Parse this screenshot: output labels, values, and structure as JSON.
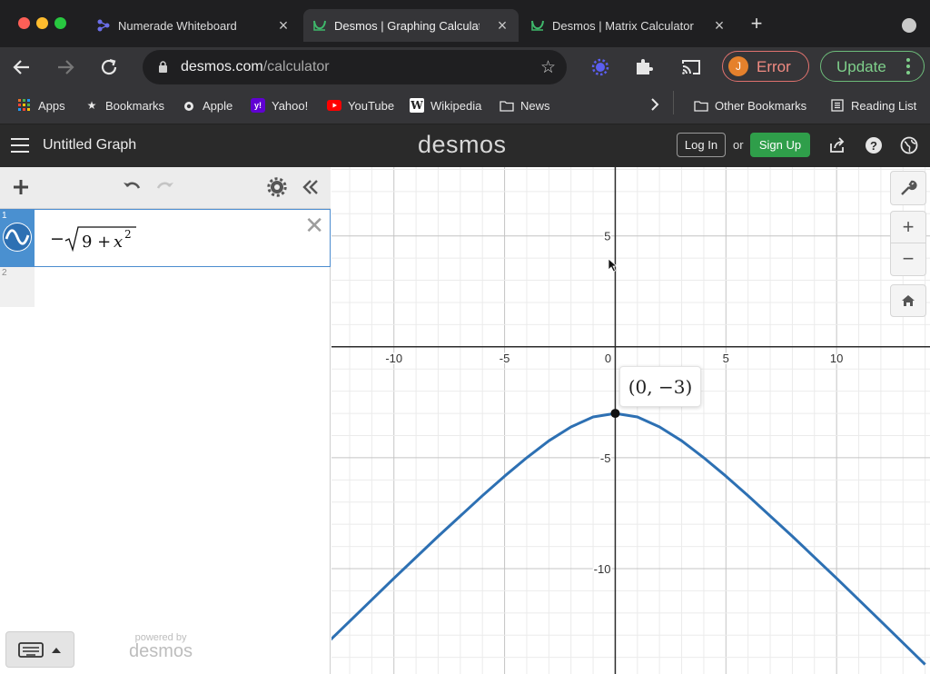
{
  "browser": {
    "tabs": [
      {
        "title": "Numerade Whiteboard",
        "active": false
      },
      {
        "title": "Desmos | Graphing Calculato",
        "active": true
      },
      {
        "title": "Desmos | Matrix Calculator",
        "active": false
      }
    ],
    "url_host": "desmos.com",
    "url_path": "/calculator",
    "profile_initial": "J",
    "profile_label": "Error",
    "update_label": "Update",
    "bookmarks": [
      "Apps",
      "Bookmarks",
      "Apple",
      "Yahoo!",
      "YouTube",
      "Wikipedia",
      "News"
    ],
    "other_bookmarks": "Other Bookmarks",
    "reading_list": "Reading List",
    "colors": {
      "update": "#7fd08b",
      "error": "#f28b82"
    }
  },
  "desmos": {
    "graph_title": "Untitled Graph",
    "logo": "desmos",
    "login_label": "Log In",
    "or_label": "or",
    "signup_label": "Sign Up",
    "expressions": [
      {
        "number": "1",
        "latex_display": "−√(9 + x²)",
        "color": "#2d70b3"
      },
      {
        "number": "2",
        "latex_display": ""
      }
    ],
    "powered_by": "powered by",
    "powered_logo": "desmos",
    "point_label": "(0, −3)",
    "colors": {
      "curve": "#2d70b3",
      "signup": "#2f9e4a",
      "expression_tab": "#4a90d0"
    }
  },
  "chart_data": {
    "type": "line",
    "function": "y = -sqrt(9 + x^2)",
    "series": [
      {
        "values": [
          [
            -13,
            -13.34
          ],
          [
            -12,
            -12.37
          ],
          [
            -10,
            -10.44
          ],
          [
            -8,
            -8.54
          ],
          [
            -6,
            -6.71
          ],
          [
            -5,
            -5.83
          ],
          [
            -4,
            -5.0
          ],
          [
            -3,
            -4.24
          ],
          [
            -2,
            -3.61
          ],
          [
            -1,
            -3.16
          ],
          [
            0,
            -3.0
          ],
          [
            1,
            -3.16
          ],
          [
            2,
            -3.61
          ],
          [
            3,
            -4.24
          ],
          [
            4,
            -5.0
          ],
          [
            5,
            -5.83
          ],
          [
            6,
            -6.71
          ],
          [
            8,
            -8.54
          ],
          [
            10,
            -10.44
          ],
          [
            12,
            -12.37
          ],
          [
            14,
            -14.32
          ]
        ]
      }
    ],
    "highlight_point": {
      "x": 0,
      "y": -3
    },
    "x_ticks": [
      -10,
      -5,
      0,
      5,
      10
    ],
    "y_ticks": [
      5,
      -5,
      -10
    ],
    "xlim": [
      -12.82,
      14.22
    ],
    "ylim": [
      -14.75,
      8.1
    ],
    "grid": true
  }
}
